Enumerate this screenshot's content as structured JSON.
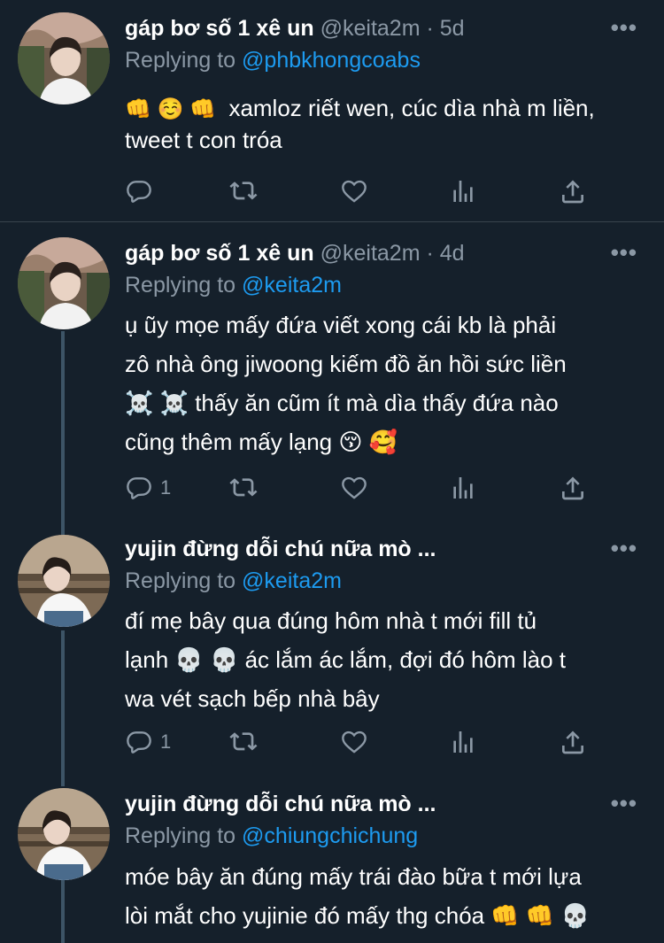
{
  "tweets": [
    {
      "name": "gáp bơ số 1 xê un",
      "handle": "@keita2m",
      "dot": "·",
      "time": "5d",
      "replying_prefix": "Replying to",
      "replying_to": "@phbkhongcoabs",
      "body_prefix": "👊 ☺️ 👊",
      "body": "xamloz riết wen, cúc dìa nhà m liền, tweet t con tróa",
      "reply_count": "",
      "more": "•••"
    },
    {
      "name": "gáp bơ số 1 xê un",
      "handle": "@keita2m",
      "dot": "·",
      "time": "4d",
      "replying_prefix": "Replying to",
      "replying_to": "@keita2m",
      "body_lines": [
        "ụ ũy mọe mấy đứa viết xong cái kb là phải",
        "zô nhà ông jiwoong kiếm đồ ăn hồi sức liền",
        "☠️ ☠️  thấy ăn cũm ít mà dìa thấy đứa nào",
        "cũng thêm mấy lạng 😚 🥰"
      ],
      "reply_count": "1",
      "more": "•••"
    },
    {
      "name": "yujin đừng dỗi chú nữa mò ...",
      "replying_prefix": "Replying to",
      "replying_to": "@keita2m",
      "body_lines": [
        "đí mẹ bây qua đúng hôm nhà t mới fill tủ",
        "lạnh 💀 💀  ác lắm ác lắm, đợi đó hôm lào t",
        "wa vét sạch bếp nhà bây"
      ],
      "reply_count": "1",
      "more": "•••"
    },
    {
      "name": "yujin đừng dỗi chú nữa mò ...",
      "replying_prefix": "Replying to",
      "replying_to": "@chiungchichung",
      "body_lines": [
        "móe bây ăn đúng mấy trái đào bữa t mới lựa",
        "lòi mắt cho yujinie đó mấy thg chóa 👊 👊 💀"
      ],
      "more": "•••"
    }
  ],
  "icons": {
    "reply": "reply-icon",
    "retweet": "retweet-icon",
    "like": "heart-icon",
    "views": "views-icon",
    "share": "share-icon"
  },
  "colors": {
    "background": "#15202b",
    "muted": "#8b98a5",
    "link": "#1d9bf0",
    "thread_line": "#3d5466"
  }
}
